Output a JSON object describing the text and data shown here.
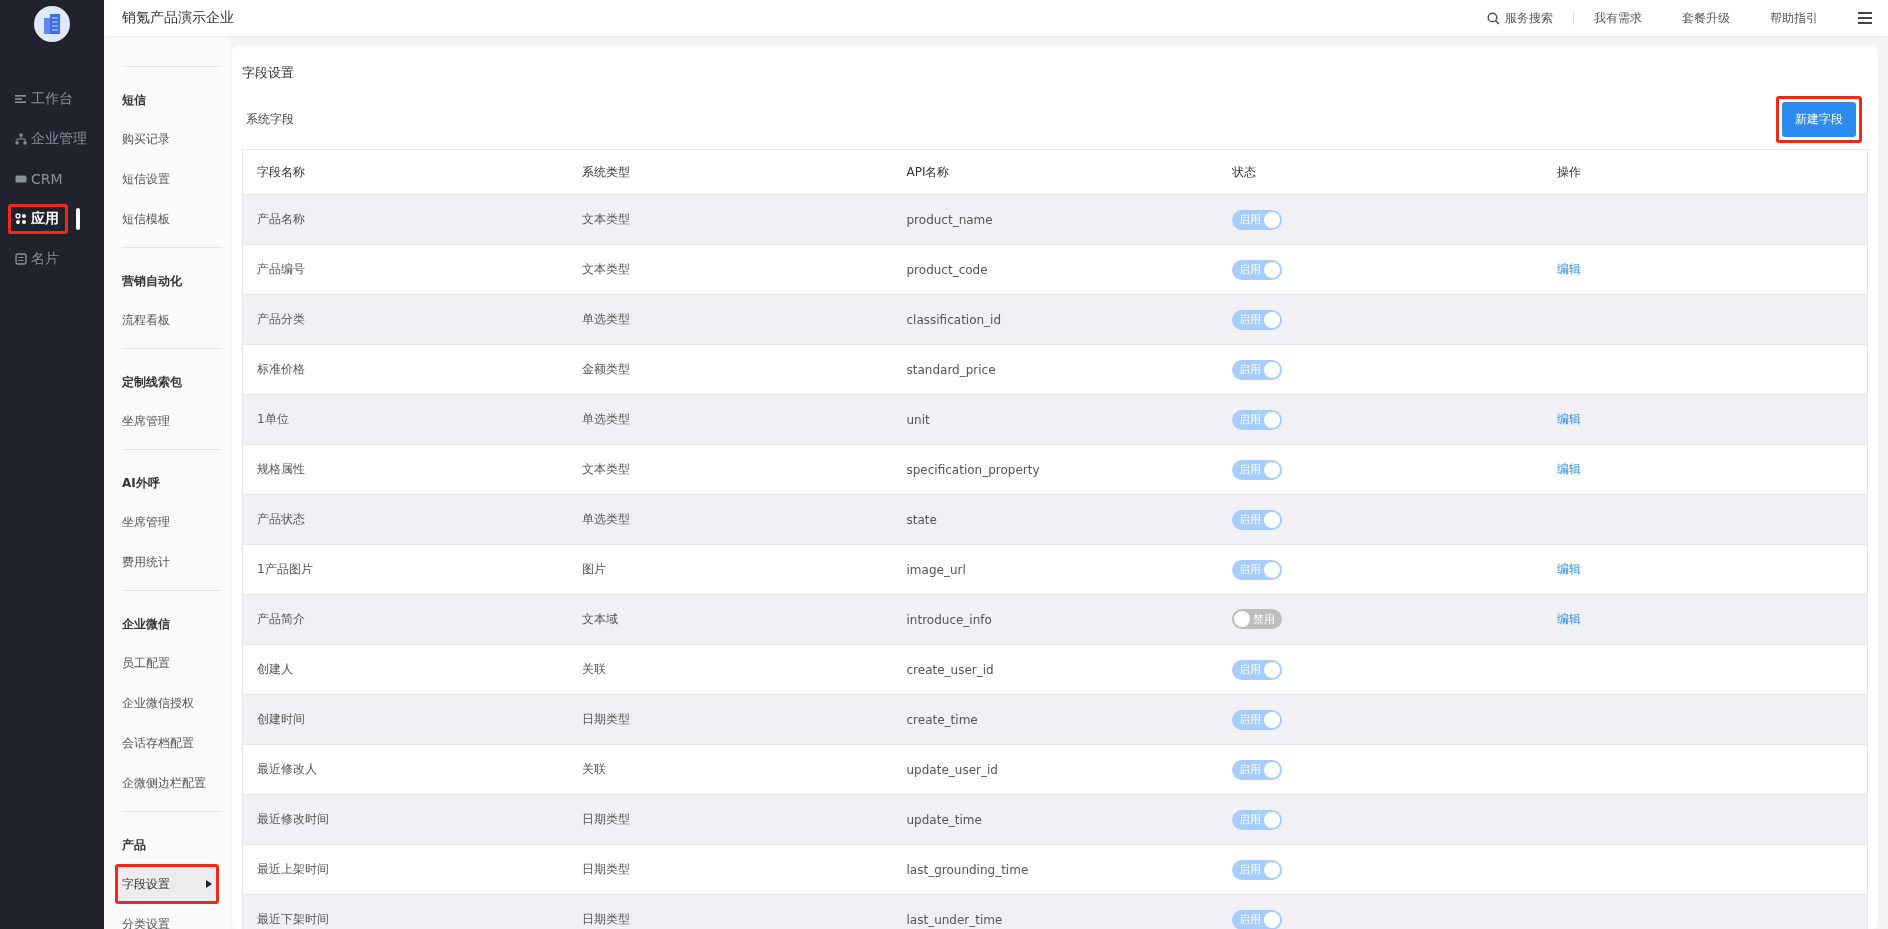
{
  "nav": {
    "items": [
      {
        "label": "工作台",
        "selected": false,
        "highlighted": false
      },
      {
        "label": "企业管理",
        "selected": false,
        "highlighted": false
      },
      {
        "label": "CRM",
        "selected": false,
        "highlighted": false
      },
      {
        "label": "应用",
        "selected": true,
        "highlighted": true
      },
      {
        "label": "名片",
        "selected": false,
        "highlighted": false
      }
    ]
  },
  "header": {
    "title": "销氪产品演示企业",
    "search": "服务搜索",
    "links": [
      "我有需求",
      "套餐升级",
      "帮助指引"
    ]
  },
  "submenu": {
    "groups": [
      {
        "title": "短信",
        "items": [
          {
            "label": "购买记录",
            "selected": false,
            "highlighted": false
          },
          {
            "label": "短信设置",
            "selected": false,
            "highlighted": false
          },
          {
            "label": "短信模板",
            "selected": false,
            "highlighted": false
          }
        ]
      },
      {
        "title": "营销自动化",
        "items": [
          {
            "label": "流程看板",
            "selected": false,
            "highlighted": false
          }
        ]
      },
      {
        "title": "定制线索包",
        "items": [
          {
            "label": "坐席管理",
            "selected": false,
            "highlighted": false
          }
        ]
      },
      {
        "title": "AI外呼",
        "items": [
          {
            "label": "坐席管理",
            "selected": false,
            "highlighted": false
          },
          {
            "label": "费用统计",
            "selected": false,
            "highlighted": false
          }
        ]
      },
      {
        "title": "企业微信",
        "items": [
          {
            "label": "员工配置",
            "selected": false,
            "highlighted": false
          },
          {
            "label": "企业微信授权",
            "selected": false,
            "highlighted": false
          },
          {
            "label": "会话存档配置",
            "selected": false,
            "highlighted": false
          },
          {
            "label": "企微侧边栏配置",
            "selected": false,
            "highlighted": false
          }
        ]
      },
      {
        "title": "产品",
        "items": [
          {
            "label": "字段设置",
            "selected": true,
            "highlighted": true
          },
          {
            "label": "分类设置",
            "selected": false,
            "highlighted": false
          }
        ]
      }
    ]
  },
  "page": {
    "title": "字段设置",
    "section": "系统字段",
    "new_button": {
      "label": "新建字段",
      "highlighted": true
    }
  },
  "table": {
    "columns": [
      "字段名称",
      "系统类型",
      "API名称",
      "状态",
      "操作"
    ],
    "rows": [
      {
        "name": "产品名称",
        "type": "文本类型",
        "api": "product_name",
        "on": true,
        "status": "启用"
      },
      {
        "name": "产品编号",
        "type": "文本类型",
        "api": "product_code",
        "on": true,
        "status": "启用",
        "action": "编辑"
      },
      {
        "name": "产品分类",
        "type": "单选类型",
        "api": "classification_id",
        "on": true,
        "status": "启用"
      },
      {
        "name": "标准价格",
        "type": "金额类型",
        "api": "standard_price",
        "on": true,
        "status": "启用"
      },
      {
        "name": "1单位",
        "type": "单选类型",
        "api": "unit",
        "on": true,
        "status": "启用",
        "action": "编辑"
      },
      {
        "name": "规格属性",
        "type": "文本类型",
        "api": "specification_property",
        "on": true,
        "status": "启用",
        "action": "编辑"
      },
      {
        "name": "产品状态",
        "type": "单选类型",
        "api": "state",
        "on": true,
        "status": "启用"
      },
      {
        "name": "1产品图片",
        "type": "图片",
        "api": "image_url",
        "on": true,
        "status": "启用",
        "action": "编辑"
      },
      {
        "name": "产品简介",
        "type": "文本域",
        "api": "introduce_info",
        "on": false,
        "status": "禁用",
        "action": "编辑"
      },
      {
        "name": "创建人",
        "type": "关联",
        "api": "create_user_id",
        "on": true,
        "status": "启用"
      },
      {
        "name": "创建时间",
        "type": "日期类型",
        "api": "create_time",
        "on": true,
        "status": "启用"
      },
      {
        "name": "最近修改人",
        "type": "关联",
        "api": "update_user_id",
        "on": true,
        "status": "启用"
      },
      {
        "name": "最近修改时间",
        "type": "日期类型",
        "api": "update_time",
        "on": true,
        "status": "启用"
      },
      {
        "name": "最近上架时间",
        "type": "日期类型",
        "api": "last_grounding_time",
        "on": true,
        "status": "启用"
      },
      {
        "name": "最近下架时间",
        "type": "日期类型",
        "api": "last_under_time",
        "on": true,
        "status": "启用"
      }
    ]
  }
}
